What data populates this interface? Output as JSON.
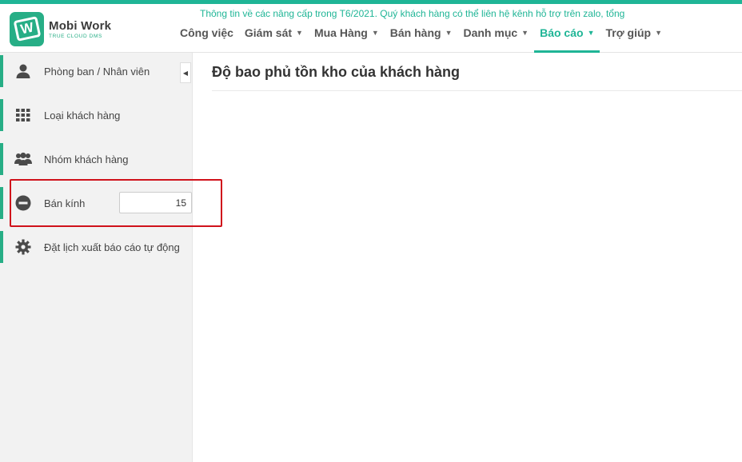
{
  "brand": {
    "name": "Mobi Work",
    "tagline": "TRUE CLOUD DMS",
    "letter": "W",
    "color": "#27ae86"
  },
  "notice": "Thông tin về các nâng cấp trong T6/2021. Quý khách hàng có thể liên hệ kênh hỗ trợ trên zalo, tổng",
  "nav": [
    {
      "label": "Công việc",
      "dropdown": false
    },
    {
      "label": "Giám sát",
      "dropdown": true
    },
    {
      "label": "Mua Hàng",
      "dropdown": true
    },
    {
      "label": "Bán hàng",
      "dropdown": true
    },
    {
      "label": "Danh mục",
      "dropdown": true
    },
    {
      "label": "Báo cáo",
      "dropdown": true,
      "active": true
    },
    {
      "label": "Trợ giúp",
      "dropdown": true
    }
  ],
  "sidebar": {
    "items": [
      {
        "label": "Phòng ban / Nhân viên",
        "icon": "user-icon"
      },
      {
        "label": "Loại khách hàng",
        "icon": "grid-icon"
      },
      {
        "label": "Nhóm khách hàng",
        "icon": "users-icon"
      },
      {
        "label": "Bán kính",
        "icon": "minus-circle-icon",
        "value": "15"
      },
      {
        "label": "Đặt lịch xuất báo cáo tự động",
        "icon": "gear-icon"
      }
    ]
  },
  "main": {
    "title": "Độ bao phủ tồn kho của khách hàng"
  },
  "colors": {
    "accent": "#1fb596",
    "highlight": "#d0121b"
  }
}
